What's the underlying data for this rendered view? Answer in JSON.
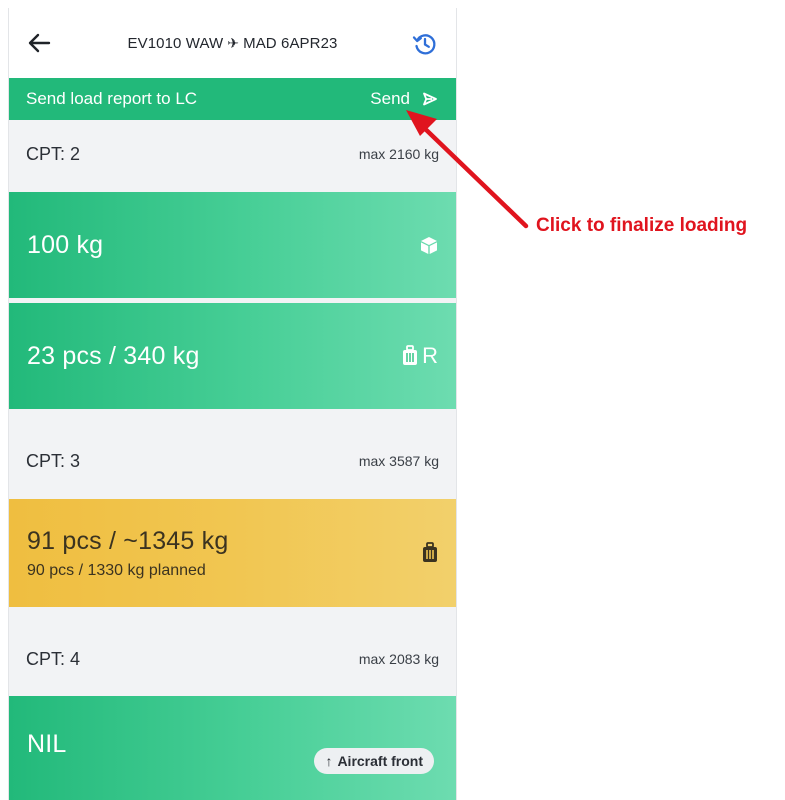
{
  "header": {
    "flight": "EV1010 WAW",
    "plane_glyph": "✈",
    "destination": "MAD 6APR23",
    "back_icon": "arrow-left-icon",
    "history_icon": "history-icon"
  },
  "send_bar": {
    "label": "Send load report to LC",
    "button_label": "Send",
    "button_icon": "send-icon"
  },
  "sections": [
    {
      "cpt": "CPT: 2",
      "max": "max 2160 kg",
      "cards": [
        {
          "main": "100 kg",
          "icon": "cargo-box-icon"
        },
        {
          "main": "23 pcs / 340 kg",
          "icon": "baggage-icon",
          "icon_suffix": "R"
        }
      ]
    },
    {
      "cpt": "CPT: 3",
      "max": "max 3587 kg",
      "cards": [
        {
          "main": "91 pcs / ~1345 kg",
          "sub": "90 pcs / 1330 kg planned",
          "icon": "baggage-icon"
        }
      ]
    },
    {
      "cpt": "CPT: 4",
      "max": "max 2083 kg",
      "cards": [
        {
          "main": "NIL"
        }
      ]
    }
  ],
  "aircraft_pill": {
    "arrow": "↑",
    "label": "Aircraft front"
  },
  "annotation": {
    "text": "Click to finalize loading",
    "color": "#e0141e"
  },
  "colors": {
    "green": "#22b97a",
    "yellow": "#efbe40",
    "history_blue": "#2f6fd8"
  }
}
